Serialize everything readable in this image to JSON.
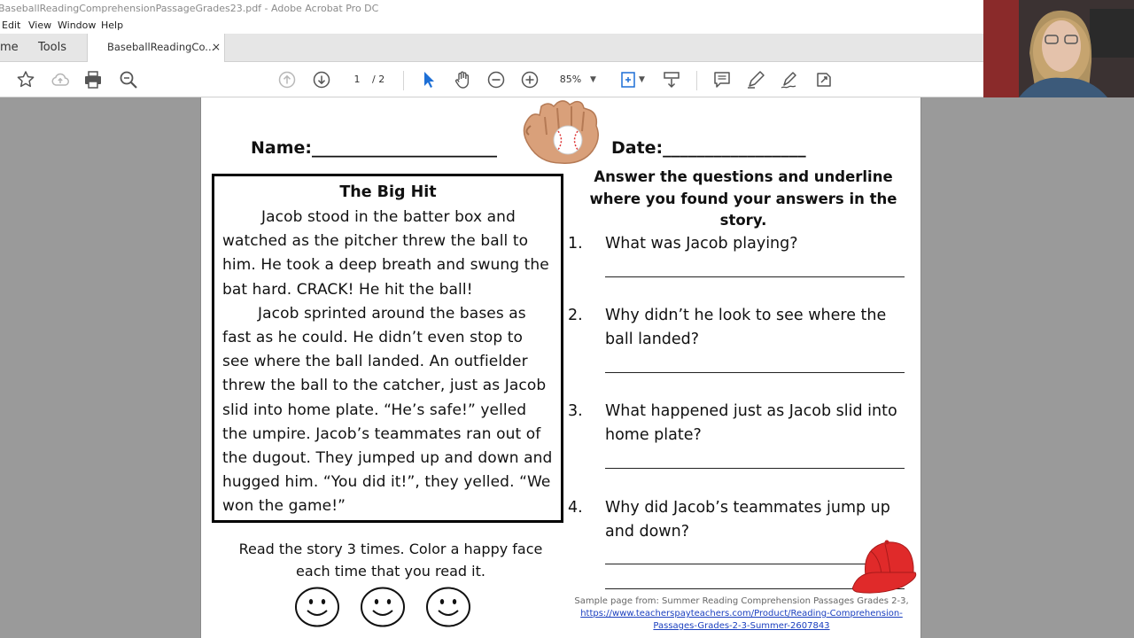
{
  "window": {
    "title": "BaseballReadingComprehensionPassageGrades23.pdf - Adobe Acrobat Pro DC"
  },
  "menu": {
    "items": [
      "Edit",
      "View",
      "Window",
      "Help"
    ]
  },
  "tabs": {
    "home": "me",
    "tools": "Tools",
    "document": "BaseballReadingCo...",
    "close": "×"
  },
  "toolbar": {
    "icons": [
      "bookmark-star-icon",
      "cloud-upload-icon",
      "print-icon",
      "search-icon",
      "prev-page-icon",
      "next-page-icon",
      "select-arrow-icon",
      "hand-tool-icon",
      "zoom-out-icon",
      "zoom-in-icon",
      "fit-page-icon",
      "scroll-mode-icon",
      "comment-icon",
      "pen-icon",
      "sign-icon",
      "more-tools-icon"
    ],
    "page_current": "1",
    "page_total": "/ 2",
    "zoom": "85%"
  },
  "document": {
    "name_label": "Name:______________________",
    "date_label": "Date:_________________",
    "story": {
      "title": "The Big Hit",
      "para1": "Jacob stood in the batter box and watched as the pitcher threw the ball to him. He took a deep breath and swung the bat hard. CRACK! He hit the ball!",
      "para2": "Jacob sprinted around the bases as fast as he could. He didn’t even stop to see where the ball landed. An outfielder threw the ball to the catcher, just as Jacob slid into home plate. “He’s safe!” yelled the umpire. Jacob’s teammates ran out of the dugout. They jumped up and down and hugged him. “You did it!”, they yelled. “We won the game!”"
    },
    "instruction": "Read the story 3 times. Color a happy face each time that you read it.",
    "questions_heading": "Answer the questions and underline where you found your answers in the story.",
    "questions": [
      {
        "num": "1.",
        "text": "What was Jacob playing?"
      },
      {
        "num": "2.",
        "text": "Why didn’t he look to see where the ball landed?"
      },
      {
        "num": "3.",
        "text": "What happened just as Jacob slid into home plate?"
      },
      {
        "num": "4.",
        "text": "Why did Jacob’s teammates jump up and down?"
      }
    ],
    "footer_line1": "Sample page from: Summer Reading Comprehension Passages Grades 2-3,",
    "footer_link": "https://www.teacherspayteachers.com/Product/Reading-Comprehension-Passages-Grades-2-3-Summer-2607843"
  },
  "colors": {
    "link": "#1a3fbf",
    "cap_red": "#e02a2a",
    "glove_tan": "#d9a07a"
  }
}
